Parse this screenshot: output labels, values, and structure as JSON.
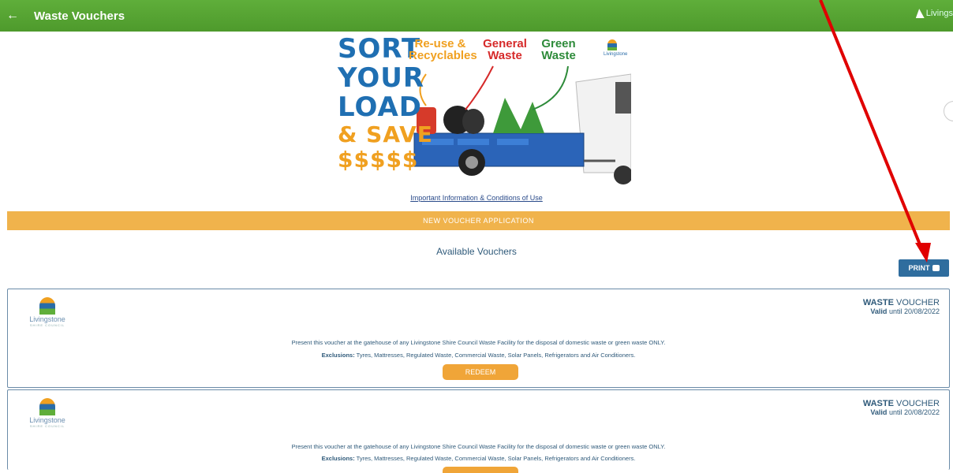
{
  "header": {
    "back_icon": "back-arrow-icon",
    "title": "Waste Vouchers",
    "logo_text": "Livings"
  },
  "banner": {
    "sort_lines": [
      "SORT",
      "YOUR",
      "LOAD"
    ],
    "save_lines": [
      "& SAVE",
      "$$$$$"
    ],
    "label_reuse": "Re-use & Recyclables",
    "label_general": "General Waste",
    "label_green": "Green Waste",
    "logo_text": "Livingstone"
  },
  "info_link": "Important Information & Conditions of Use",
  "new_application_label": "NEW VOUCHER APPLICATION",
  "available_title": "Available Vouchers",
  "print_label": "PRINT",
  "vouchers": [
    {
      "logo_name": "Livingstone",
      "logo_sub": "SHIRE COUNCIL",
      "type_bold": "WASTE",
      "type_rest": " VOUCHER",
      "valid_bold": "Valid",
      "valid_rest": " until 20/08/2022",
      "description": "Present this voucher at the gatehouse of any Livingstone Shire Council Waste Facility for the disposal of domestic waste or green waste ONLY.",
      "exclusions_label": "Exclusions:",
      "exclusions_text": " Tyres, Mattresses, Regulated Waste, Commercial Waste, Solar Panels, Refrigerators and Air Conditioners.",
      "redeem_label": "REDEEM"
    },
    {
      "logo_name": "Livingstone",
      "logo_sub": "SHIRE COUNCIL",
      "type_bold": "WASTE",
      "type_rest": " VOUCHER",
      "valid_bold": "Valid",
      "valid_rest": " until 20/08/2022",
      "description": "Present this voucher at the gatehouse of any Livingstone Shire Council Waste Facility for the disposal of domestic waste or green waste ONLY.",
      "exclusions_label": "Exclusions:",
      "exclusions_text": " Tyres, Mattresses, Regulated Waste, Commercial Waste, Solar Panels, Refrigerators and Air Conditioners."
    }
  ],
  "colors": {
    "header_green": "#5fae3a",
    "accent_orange": "#f0b34c",
    "print_blue": "#2f6d9e",
    "annotation_red": "#e00000"
  }
}
